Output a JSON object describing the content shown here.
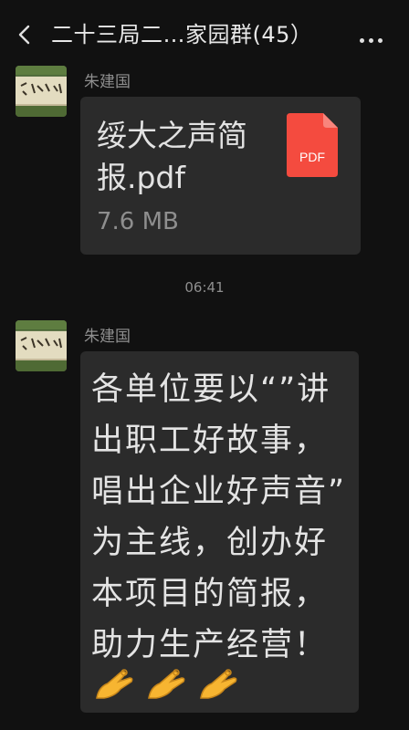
{
  "header": {
    "title": "二十三局二…家园群(45）",
    "back_icon": "chevron-left-icon",
    "more_icon": "more-dots-icon"
  },
  "messages": [
    {
      "sender": "朱建国",
      "type": "file",
      "file_name": "绥大之声简报.pdf",
      "file_name_lines": [
        "绥大之声简",
        "报.pdf"
      ],
      "file_size": "7.6 MB",
      "file_badge": "PDF",
      "badge_color": "#f44b3f"
    },
    {
      "sender": "朱建国",
      "type": "text",
      "lines": [
        "各单位要以“”讲",
        "出职工好故事，",
        "唱出企业好声音”",
        "为主线，创办好",
        "本项目的简报，",
        "助力生产经营！"
      ],
      "emojis": [
        "ok-hand-icon",
        "ok-hand-icon",
        "ok-hand-icon"
      ]
    }
  ],
  "timestamp": "06:41",
  "colors": {
    "background": "#111111",
    "bubble": "#2b2b2b",
    "muted_text": "#8f8f8f"
  }
}
